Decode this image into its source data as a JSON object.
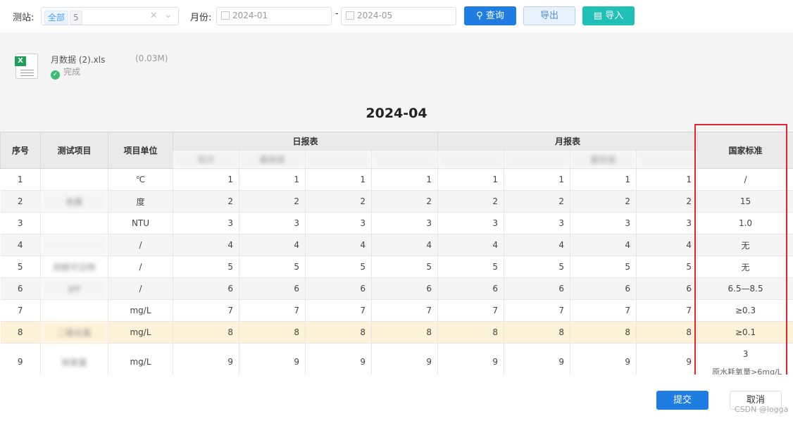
{
  "toolbar": {
    "station_label": "测站:",
    "station_tag": "全部",
    "station_count": "5",
    "clear_icon": "close-icon",
    "month_label": "月份:",
    "date_from": "2024-01",
    "date_sep": "-",
    "date_to": "2024-05",
    "query_label": "查询",
    "export_label": "导出",
    "import_label": "导入"
  },
  "upload": {
    "file_name": "月数据 (2).xls",
    "file_size": "(0.03M)",
    "status": "完成"
  },
  "report": {
    "title": "2024-04",
    "columns": {
      "index": "序号",
      "item": "测试项目",
      "unit": "项目单位",
      "daily": "日报表",
      "monthly": "月报表",
      "standard": "国家标准",
      "daily_sub": [
        "验次",
        "最高值",
        "",
        ""
      ],
      "monthly_sub": [
        "",
        "",
        "最低值",
        ""
      ]
    },
    "rows": [
      {
        "no": "1",
        "item": "",
        "unit": "℃",
        "d1": "1",
        "d2": "1",
        "d3": "1",
        "d4": "1",
        "m1": "1",
        "m2": "1",
        "m3": "1",
        "m4": "1",
        "std": "/"
      },
      {
        "no": "2",
        "item": "色度",
        "unit": "度",
        "d1": "2",
        "d2": "2",
        "d3": "2",
        "d4": "2",
        "m1": "2",
        "m2": "2",
        "m3": "2",
        "m4": "2",
        "std": "15"
      },
      {
        "no": "3",
        "item": "",
        "unit": "NTU",
        "d1": "3",
        "d2": "3",
        "d3": "3",
        "d4": "3",
        "m1": "3",
        "m2": "3",
        "m3": "3",
        "m4": "3",
        "std": "1.0"
      },
      {
        "no": "4",
        "item": "",
        "unit": "/",
        "d1": "4",
        "d2": "4",
        "d3": "4",
        "d4": "4",
        "m1": "4",
        "m2": "4",
        "m3": "4",
        "m4": "4",
        "std": "无"
      },
      {
        "no": "5",
        "item": "肉眼可见物",
        "unit": "/",
        "d1": "5",
        "d2": "5",
        "d3": "5",
        "d4": "5",
        "m1": "5",
        "m2": "5",
        "m3": "5",
        "m4": "5",
        "std": "无"
      },
      {
        "no": "6",
        "item": "pH",
        "unit": "/",
        "d1": "6",
        "d2": "6",
        "d3": "6",
        "d4": "6",
        "m1": "6",
        "m2": "6",
        "m3": "6",
        "m4": "6",
        "std": "6.5—8.5"
      },
      {
        "no": "7",
        "item": "",
        "unit": "mg/L",
        "d1": "7",
        "d2": "7",
        "d3": "7",
        "d4": "7",
        "m1": "7",
        "m2": "7",
        "m3": "7",
        "m4": "7",
        "std": "≥0.3"
      },
      {
        "no": "8",
        "item": "二氧化氯",
        "unit": "mg/L",
        "d1": "8",
        "d2": "8",
        "d3": "8",
        "d4": "8",
        "m1": "8",
        "m2": "8",
        "m3": "8",
        "m4": "8",
        "std": "≥0.1"
      },
      {
        "no": "9",
        "item": "耗氧量",
        "unit": "mg/L",
        "d1": "9",
        "d2": "9",
        "d3": "9",
        "d4": "9",
        "m1": "9",
        "m2": "9",
        "m3": "9",
        "m4": "9",
        "std": "3"
      }
    ],
    "row9_std_note": "原水耗氧量>6mg/L"
  },
  "footer": {
    "submit_label": "提交",
    "cancel_label": "取消"
  },
  "watermark": "CSDN @logga",
  "colors": {
    "primary": "#1f7ce0",
    "teal": "#1fc0b5",
    "highlight_border": "#e0262a",
    "highlight_row": "#fdf3d8"
  }
}
